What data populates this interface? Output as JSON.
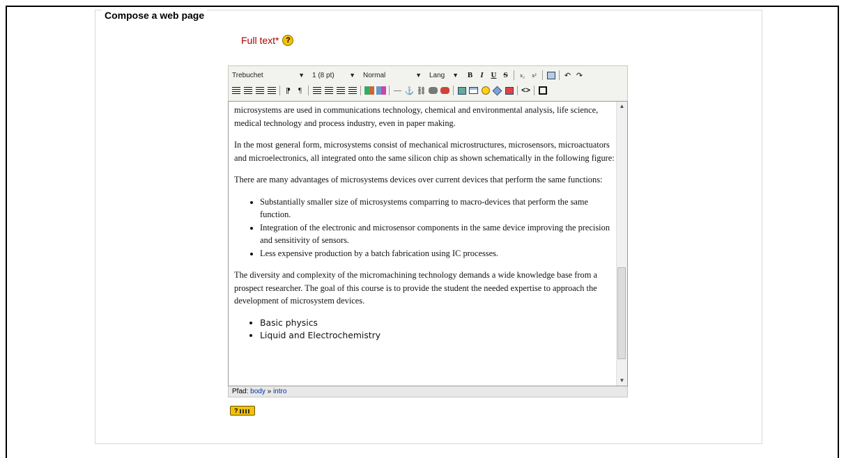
{
  "form": {
    "legend": "Compose a web page",
    "field_label": "Full text*",
    "help_icon": "?"
  },
  "toolbar": {
    "font_family": "Trebuchet",
    "font_size": "1 (8 pt)",
    "paragraph_format": "Normal",
    "language": "Lang",
    "bold": "B",
    "italic": "I",
    "underline": "U",
    "strikethrough": "S",
    "subscript": "x₂",
    "superscript": "x²",
    "undo": "↶",
    "redo": "↷",
    "ltr": "⁋",
    "rtl": "¶",
    "horizontal_rule": "—",
    "anchor": "⚓",
    "link": "⛓",
    "unlink": "⛓",
    "html": "<>"
  },
  "content": {
    "paragraphs": [
      "microsystems are used in communications technology, chemical and environmental analysis, life science, medical technology and process industry, even in paper making.",
      "In the most general form, microsystems consist of mechanical microstructures, microsensors, microactuators and microelectronics, all integrated onto the same silicon chip as shown schematically in the following figure:",
      "There are many advantages of microsystems devices over current devices that perform the same functions:"
    ],
    "advantages": [
      "Substantially smaller size of microsystems comparring to macro-devices that perform the same function.",
      "Integration of the electronic and microsensor components in the same device improving the precision and sensitivity of sensors.",
      "Less expensive production by a batch fabrication using IC processes."
    ],
    "closing_paragraph": "The diversity and complexity of the micromachining technology demands a wide knowledge base from a prospect researcher. The goal of this course is to provide the student the needed expertise to approach the development of microsystem devices.",
    "topics": [
      "Basic physics",
      "Liquid and Electrochemistry"
    ]
  },
  "pathbar": {
    "prefix": "Pfad:",
    "body": "body",
    "separator": "»",
    "intro": "intro"
  },
  "help_key": "?"
}
